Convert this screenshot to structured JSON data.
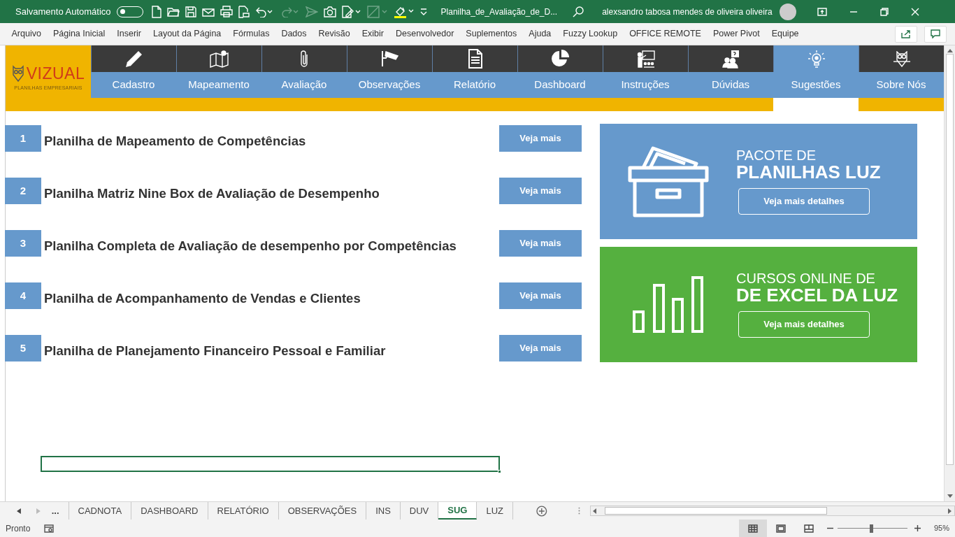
{
  "title_bar": {
    "autosave_label": "Salvamento Automático",
    "autosave_on": false,
    "title": "Planilha_de_Avaliação_de_D...",
    "user": "alexsandro tabosa mendes de oliveira oliveira"
  },
  "ribbon_tabs": [
    "Arquivo",
    "Página Inicial",
    "Inserir",
    "Layout da Página",
    "Fórmulas",
    "Dados",
    "Revisão",
    "Exibir",
    "Desenvolvedor",
    "Suplementos",
    "Ajuda",
    "Fuzzy Lookup",
    "OFFICE REMOTE",
    "Power Pivot",
    "Equipe"
  ],
  "logo": {
    "brand": "VIZUAL",
    "tagline": "PLANILHAS EMPRESARIAIS"
  },
  "nav": [
    {
      "label": "Cadastro",
      "selected": false
    },
    {
      "label": "Mapeamento",
      "selected": false
    },
    {
      "label": "Avaliação",
      "selected": false
    },
    {
      "label": "Observações",
      "selected": false
    },
    {
      "label": "Relatório",
      "selected": false
    },
    {
      "label": "Dashboard",
      "selected": false
    },
    {
      "label": "Instruções",
      "selected": false
    },
    {
      "label": "Dúvidas",
      "selected": false
    },
    {
      "label": "Sugestões",
      "selected": true
    },
    {
      "label": "Sobre Nós",
      "selected": false
    }
  ],
  "suggestions": [
    {
      "number": "1",
      "title": "Planilha de Mapeamento de Competências",
      "button": "Veja mais"
    },
    {
      "number": "2",
      "title": "Planilha Matriz Nine Box de Avaliação de Desempenho",
      "button": "Veja mais"
    },
    {
      "number": "3",
      "title": "Planilha Completa de Avaliação de desempenho por Competências",
      "button": "Veja mais"
    },
    {
      "number": "4",
      "title": "Planilha de Acompanhamento de Vendas e Clientes",
      "button": "Veja mais"
    },
    {
      "number": "5",
      "title": "Planilha de Planejamento Financeiro Pessoal e Familiar",
      "button": "Veja mais"
    }
  ],
  "promos": [
    {
      "kind": "package",
      "line1": "PACOTE DE",
      "line2": "PLANILHAS LUZ",
      "button": "Veja mais detalhes",
      "color": "#6699cc"
    },
    {
      "kind": "courses",
      "line1": "CURSOS ONLINE DE",
      "line2": "DE EXCEL DA LUZ",
      "button": "Veja mais detalhes",
      "color": "#55b03f"
    }
  ],
  "sheet_tabs_overflow": "...",
  "sheet_tabs": [
    {
      "label": "CADNOTA",
      "selected": false
    },
    {
      "label": "DASHBOARD",
      "selected": false
    },
    {
      "label": "RELATÓRIO",
      "selected": false
    },
    {
      "label": "OBSERVAÇÕES",
      "selected": false
    },
    {
      "label": "INS",
      "selected": false
    },
    {
      "label": "DUV",
      "selected": false
    },
    {
      "label": "SUG",
      "selected": true
    },
    {
      "label": "LUZ",
      "selected": false
    }
  ],
  "status_bar": {
    "text": "Pronto",
    "zoom": "95%",
    "zoom_slider": {
      "level": 0.48
    }
  }
}
